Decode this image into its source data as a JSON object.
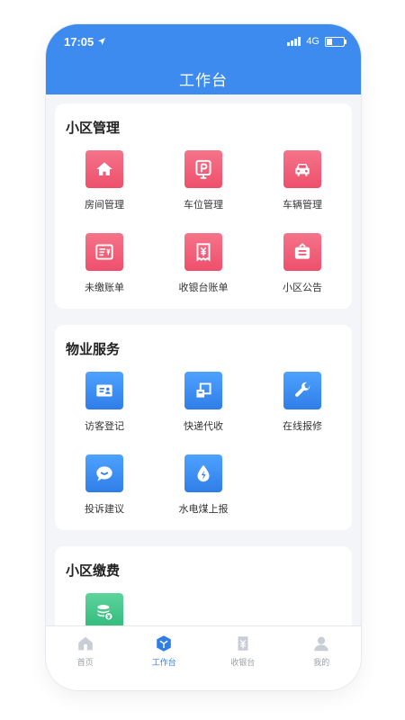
{
  "status": {
    "time": "17:05",
    "network": "4G"
  },
  "header": {
    "title": "工作台"
  },
  "sections": [
    {
      "title": "小区管理",
      "items": [
        {
          "label": "房间管理",
          "icon": "home-icon"
        },
        {
          "label": "车位管理",
          "icon": "parking-icon"
        },
        {
          "label": "车辆管理",
          "icon": "car-icon"
        },
        {
          "label": "未缴账单",
          "icon": "unpaid-bill-icon"
        },
        {
          "label": "收银台账单",
          "icon": "receipt-icon"
        },
        {
          "label": "小区公告",
          "icon": "notice-board-icon"
        }
      ]
    },
    {
      "title": "物业服务",
      "items": [
        {
          "label": "访客登记",
          "icon": "visitor-card-icon"
        },
        {
          "label": "快递代收",
          "icon": "package-icon"
        },
        {
          "label": "在线报修",
          "icon": "wrench-icon"
        },
        {
          "label": "投诉建议",
          "icon": "chat-bubble-icon"
        },
        {
          "label": "水电煤上报",
          "icon": "utility-drop-icon"
        }
      ]
    },
    {
      "title": "小区缴费",
      "items": [
        {
          "label": "",
          "icon": "coins-icon"
        }
      ]
    }
  ],
  "tabbar": [
    {
      "label": "首页",
      "icon": "home-tab-icon",
      "active": false
    },
    {
      "label": "工作台",
      "icon": "workbench-cube-icon",
      "active": true
    },
    {
      "label": "收银台",
      "icon": "cashier-icon",
      "active": false
    },
    {
      "label": "我的",
      "icon": "profile-icon",
      "active": false
    }
  ],
  "colors": {
    "primary": "#3d8bef",
    "red_icon": "#ee4f6b",
    "blue_icon": "#2f7ee8",
    "green_icon": "#2fb97a",
    "tab_active": "#2f7ee8",
    "tab_inactive": "#9aa0a6"
  }
}
